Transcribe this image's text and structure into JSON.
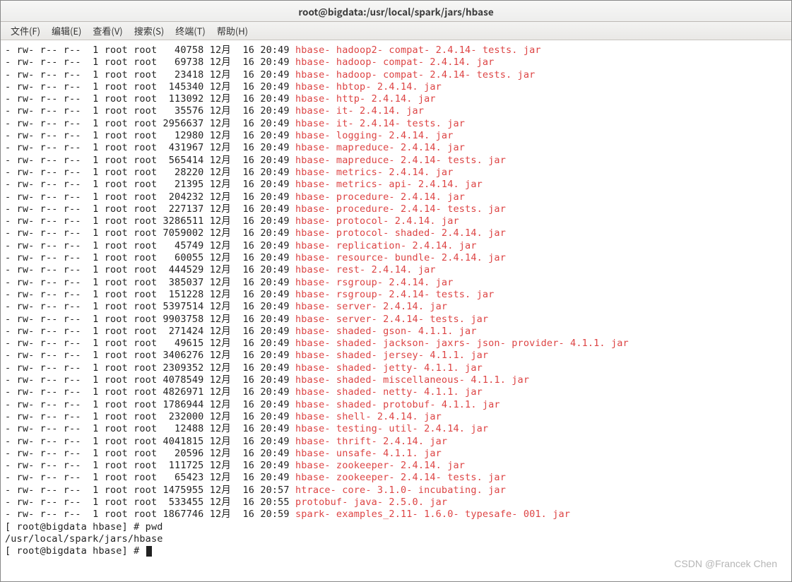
{
  "title": "root@bigdata:/usr/local/spark/jars/hbase",
  "menu": {
    "file": "文件(F)",
    "edit": "编辑(E)",
    "view": "查看(V)",
    "search": "搜索(S)",
    "term": "终端(T)",
    "help": "帮助(H)"
  },
  "rows": [
    {
      "perm": "- rw- r-- r--",
      "links": "1",
      "owner": "root",
      "group": "root",
      "size": "40758",
      "mon": "12月",
      "day": "16",
      "time": "20:49",
      "name": "hbase- hadoop2- compat- 2.4.14- tests. jar"
    },
    {
      "perm": "- rw- r-- r--",
      "links": "1",
      "owner": "root",
      "group": "root",
      "size": "69738",
      "mon": "12月",
      "day": "16",
      "time": "20:49",
      "name": "hbase- hadoop- compat- 2.4.14. jar"
    },
    {
      "perm": "- rw- r-- r--",
      "links": "1",
      "owner": "root",
      "group": "root",
      "size": "23418",
      "mon": "12月",
      "day": "16",
      "time": "20:49",
      "name": "hbase- hadoop- compat- 2.4.14- tests. jar"
    },
    {
      "perm": "- rw- r-- r--",
      "links": "1",
      "owner": "root",
      "group": "root",
      "size": "145340",
      "mon": "12月",
      "day": "16",
      "time": "20:49",
      "name": "hbase- hbtop- 2.4.14. jar"
    },
    {
      "perm": "- rw- r-- r--",
      "links": "1",
      "owner": "root",
      "group": "root",
      "size": "113092",
      "mon": "12月",
      "day": "16",
      "time": "20:49",
      "name": "hbase- http- 2.4.14. jar"
    },
    {
      "perm": "- rw- r-- r--",
      "links": "1",
      "owner": "root",
      "group": "root",
      "size": "35576",
      "mon": "12月",
      "day": "16",
      "time": "20:49",
      "name": "hbase- it- 2.4.14. jar"
    },
    {
      "perm": "- rw- r-- r--",
      "links": "1",
      "owner": "root",
      "group": "root",
      "size": "2956637",
      "mon": "12月",
      "day": "16",
      "time": "20:49",
      "name": "hbase- it- 2.4.14- tests. jar"
    },
    {
      "perm": "- rw- r-- r--",
      "links": "1",
      "owner": "root",
      "group": "root",
      "size": "12980",
      "mon": "12月",
      "day": "16",
      "time": "20:49",
      "name": "hbase- logging- 2.4.14. jar"
    },
    {
      "perm": "- rw- r-- r--",
      "links": "1",
      "owner": "root",
      "group": "root",
      "size": "431967",
      "mon": "12月",
      "day": "16",
      "time": "20:49",
      "name": "hbase- mapreduce- 2.4.14. jar"
    },
    {
      "perm": "- rw- r-- r--",
      "links": "1",
      "owner": "root",
      "group": "root",
      "size": "565414",
      "mon": "12月",
      "day": "16",
      "time": "20:49",
      "name": "hbase- mapreduce- 2.4.14- tests. jar"
    },
    {
      "perm": "- rw- r-- r--",
      "links": "1",
      "owner": "root",
      "group": "root",
      "size": "28220",
      "mon": "12月",
      "day": "16",
      "time": "20:49",
      "name": "hbase- metrics- 2.4.14. jar"
    },
    {
      "perm": "- rw- r-- r--",
      "links": "1",
      "owner": "root",
      "group": "root",
      "size": "21395",
      "mon": "12月",
      "day": "16",
      "time": "20:49",
      "name": "hbase- metrics- api- 2.4.14. jar"
    },
    {
      "perm": "- rw- r-- r--",
      "links": "1",
      "owner": "root",
      "group": "root",
      "size": "204232",
      "mon": "12月",
      "day": "16",
      "time": "20:49",
      "name": "hbase- procedure- 2.4.14. jar"
    },
    {
      "perm": "- rw- r-- r--",
      "links": "1",
      "owner": "root",
      "group": "root",
      "size": "227137",
      "mon": "12月",
      "day": "16",
      "time": "20:49",
      "name": "hbase- procedure- 2.4.14- tests. jar"
    },
    {
      "perm": "- rw- r-- r--",
      "links": "1",
      "owner": "root",
      "group": "root",
      "size": "3286511",
      "mon": "12月",
      "day": "16",
      "time": "20:49",
      "name": "hbase- protocol- 2.4.14. jar"
    },
    {
      "perm": "- rw- r-- r--",
      "links": "1",
      "owner": "root",
      "group": "root",
      "size": "7059002",
      "mon": "12月",
      "day": "16",
      "time": "20:49",
      "name": "hbase- protocol- shaded- 2.4.14. jar"
    },
    {
      "perm": "- rw- r-- r--",
      "links": "1",
      "owner": "root",
      "group": "root",
      "size": "45749",
      "mon": "12月",
      "day": "16",
      "time": "20:49",
      "name": "hbase- replication- 2.4.14. jar"
    },
    {
      "perm": "- rw- r-- r--",
      "links": "1",
      "owner": "root",
      "group": "root",
      "size": "60055",
      "mon": "12月",
      "day": "16",
      "time": "20:49",
      "name": "hbase- resource- bundle- 2.4.14. jar"
    },
    {
      "perm": "- rw- r-- r--",
      "links": "1",
      "owner": "root",
      "group": "root",
      "size": "444529",
      "mon": "12月",
      "day": "16",
      "time": "20:49",
      "name": "hbase- rest- 2.4.14. jar"
    },
    {
      "perm": "- rw- r-- r--",
      "links": "1",
      "owner": "root",
      "group": "root",
      "size": "385037",
      "mon": "12月",
      "day": "16",
      "time": "20:49",
      "name": "hbase- rsgroup- 2.4.14. jar"
    },
    {
      "perm": "- rw- r-- r--",
      "links": "1",
      "owner": "root",
      "group": "root",
      "size": "151228",
      "mon": "12月",
      "day": "16",
      "time": "20:49",
      "name": "hbase- rsgroup- 2.4.14- tests. jar"
    },
    {
      "perm": "- rw- r-- r--",
      "links": "1",
      "owner": "root",
      "group": "root",
      "size": "5397514",
      "mon": "12月",
      "day": "16",
      "time": "20:49",
      "name": "hbase- server- 2.4.14. jar"
    },
    {
      "perm": "- rw- r-- r--",
      "links": "1",
      "owner": "root",
      "group": "root",
      "size": "9903758",
      "mon": "12月",
      "day": "16",
      "time": "20:49",
      "name": "hbase- server- 2.4.14- tests. jar"
    },
    {
      "perm": "- rw- r-- r--",
      "links": "1",
      "owner": "root",
      "group": "root",
      "size": "271424",
      "mon": "12月",
      "day": "16",
      "time": "20:49",
      "name": "hbase- shaded- gson- 4.1.1. jar"
    },
    {
      "perm": "- rw- r-- r--",
      "links": "1",
      "owner": "root",
      "group": "root",
      "size": "49615",
      "mon": "12月",
      "day": "16",
      "time": "20:49",
      "name": "hbase- shaded- jackson- jaxrs- json- provider- 4.1.1. jar"
    },
    {
      "perm": "- rw- r-- r--",
      "links": "1",
      "owner": "root",
      "group": "root",
      "size": "3406276",
      "mon": "12月",
      "day": "16",
      "time": "20:49",
      "name": "hbase- shaded- jersey- 4.1.1. jar"
    },
    {
      "perm": "- rw- r-- r--",
      "links": "1",
      "owner": "root",
      "group": "root",
      "size": "2309352",
      "mon": "12月",
      "day": "16",
      "time": "20:49",
      "name": "hbase- shaded- jetty- 4.1.1. jar"
    },
    {
      "perm": "- rw- r-- r--",
      "links": "1",
      "owner": "root",
      "group": "root",
      "size": "4078549",
      "mon": "12月",
      "day": "16",
      "time": "20:49",
      "name": "hbase- shaded- miscellaneous- 4.1.1. jar"
    },
    {
      "perm": "- rw- r-- r--",
      "links": "1",
      "owner": "root",
      "group": "root",
      "size": "4826971",
      "mon": "12月",
      "day": "16",
      "time": "20:49",
      "name": "hbase- shaded- netty- 4.1.1. jar"
    },
    {
      "perm": "- rw- r-- r--",
      "links": "1",
      "owner": "root",
      "group": "root",
      "size": "1786944",
      "mon": "12月",
      "day": "16",
      "time": "20:49",
      "name": "hbase- shaded- protobuf- 4.1.1. jar"
    },
    {
      "perm": "- rw- r-- r--",
      "links": "1",
      "owner": "root",
      "group": "root",
      "size": "232000",
      "mon": "12月",
      "day": "16",
      "time": "20:49",
      "name": "hbase- shell- 2.4.14. jar"
    },
    {
      "perm": "- rw- r-- r--",
      "links": "1",
      "owner": "root",
      "group": "root",
      "size": "12488",
      "mon": "12月",
      "day": "16",
      "time": "20:49",
      "name": "hbase- testing- util- 2.4.14. jar"
    },
    {
      "perm": "- rw- r-- r--",
      "links": "1",
      "owner": "root",
      "group": "root",
      "size": "4041815",
      "mon": "12月",
      "day": "16",
      "time": "20:49",
      "name": "hbase- thrift- 2.4.14. jar"
    },
    {
      "perm": "- rw- r-- r--",
      "links": "1",
      "owner": "root",
      "group": "root",
      "size": "20596",
      "mon": "12月",
      "day": "16",
      "time": "20:49",
      "name": "hbase- unsafe- 4.1.1. jar"
    },
    {
      "perm": "- rw- r-- r--",
      "links": "1",
      "owner": "root",
      "group": "root",
      "size": "111725",
      "mon": "12月",
      "day": "16",
      "time": "20:49",
      "name": "hbase- zookeeper- 2.4.14. jar"
    },
    {
      "perm": "- rw- r-- r--",
      "links": "1",
      "owner": "root",
      "group": "root",
      "size": "65423",
      "mon": "12月",
      "day": "16",
      "time": "20:49",
      "name": "hbase- zookeeper- 2.4.14- tests. jar"
    },
    {
      "perm": "- rw- r-- r--",
      "links": "1",
      "owner": "root",
      "group": "root",
      "size": "1475955",
      "mon": "12月",
      "day": "16",
      "time": "20:57",
      "name": "htrace- core- 3.1.0- incubating. jar"
    },
    {
      "perm": "- rw- r-- r--",
      "links": "1",
      "owner": "root",
      "group": "root",
      "size": "533455",
      "mon": "12月",
      "day": "16",
      "time": "20:55",
      "name": "protobuf- java- 2.5.0. jar"
    },
    {
      "perm": "- rw- r-- r--",
      "links": "1",
      "owner": "root",
      "group": "root",
      "size": "1867746",
      "mon": "12月",
      "day": "16",
      "time": "20:59",
      "name": "spark- examples_2.11- 1.6.0- typesafe- 001. jar"
    }
  ],
  "prompt1": "[ root@bigdata hbase] # pwd",
  "pwd_output": "/usr/local/spark/jars/hbase",
  "prompt2": "[ root@bigdata hbase] # ",
  "watermark": "CSDN @Francek Chen"
}
